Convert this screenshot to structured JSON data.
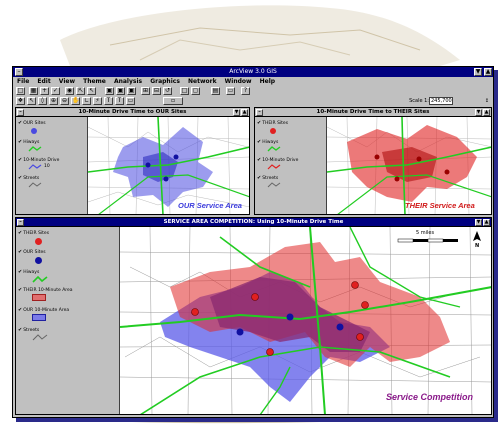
{
  "app": {
    "title": "ArcView 3.0 GIS",
    "menu": [
      "File",
      "Edit",
      "View",
      "Theme",
      "Analysis",
      "Graphics",
      "Network",
      "Window",
      "Help"
    ],
    "scale_label": "Scale 1:",
    "scale_value": "245,700",
    "coords": "↕"
  },
  "views": {
    "our": {
      "title": "10-Minute Drive Time to OUR Sites",
      "layers": [
        "OUR Sites",
        "Hiways",
        "10-Minute Drive",
        "Streets"
      ],
      "sublabel": "10",
      "map_label": "OUR Service Area",
      "label_color": "#3b3bdc"
    },
    "their": {
      "title": "10-Minute Drive Time to THEIR Sites",
      "layers": [
        "THEIR Sites",
        "Hiways",
        "10-Minute Drive",
        "Streets"
      ],
      "map_label": "THEIR Service Area",
      "label_color": "#d01818"
    },
    "competition": {
      "title": "SERVICE AREA COMPETITION:  Using 10-Minute Drive Time",
      "layers": [
        "THEIR Sites",
        "OUR Sites",
        "Hiways",
        "THEIR 10-Minute Area",
        "OUR 10-Minute Area",
        "Streets"
      ],
      "scalebar_label": "5 miles",
      "north_label": "N",
      "map_label": "Service Competition",
      "label_color": "#8a1a8a"
    }
  },
  "colors": {
    "our_area": "#4a4ae0",
    "their_area": "#e02020",
    "overlap": "#9a2a6a",
    "hiway": "#22cc22",
    "titlebar": "#000080"
  }
}
